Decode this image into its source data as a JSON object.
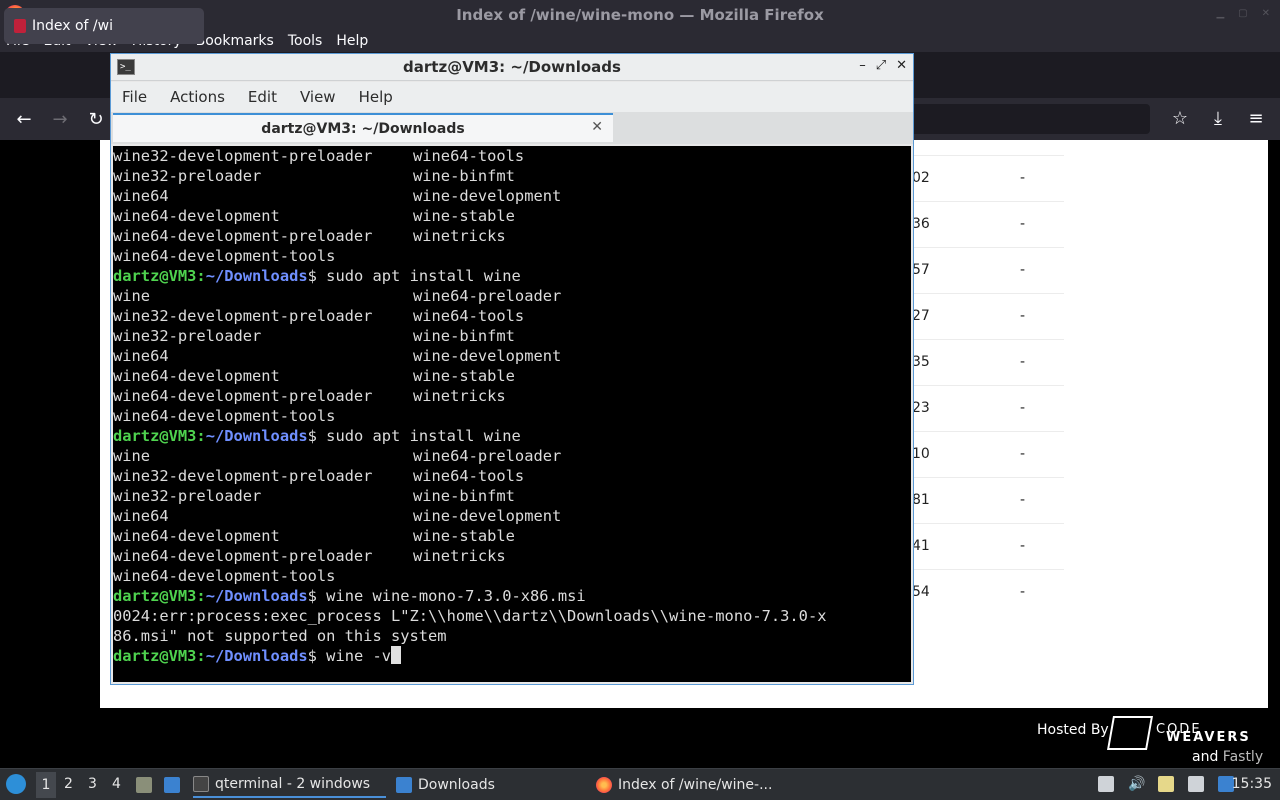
{
  "firefox": {
    "window_title": "Index of /wine/wine-mono — Mozilla Firefox",
    "menu": [
      "File",
      "Edit",
      "View",
      "History",
      "Bookmarks",
      "Tools",
      "Help"
    ],
    "tab_title": "Index of /wine/wine-mono",
    "tab_title_visible": "Index of /wi"
  },
  "page": {
    "rows": [
      {
        "size": "02",
        "mod": "-"
      },
      {
        "size": "36",
        "mod": "-"
      },
      {
        "size": "57",
        "mod": "-"
      },
      {
        "size": "27",
        "mod": "-"
      },
      {
        "size": "35",
        "mod": "-"
      },
      {
        "size": "23",
        "mod": "-"
      },
      {
        "size": "10",
        "mod": "-"
      },
      {
        "size": "81",
        "mod": "-"
      },
      {
        "size": "41",
        "mod": "-"
      },
      {
        "size": "54",
        "mod": "-"
      }
    ],
    "hosted_by": "Hosted By",
    "codeweavers_top": "CODE",
    "codeweavers_bottom": "WEAVERS",
    "and": "and",
    "fastly": "Fastly"
  },
  "terminal": {
    "window_title": "dartz@VM3: ~/Downloads",
    "menu": [
      "File",
      "Actions",
      "Edit",
      "View",
      "Help"
    ],
    "tab_title": "dartz@VM3: ~/Downloads",
    "prompt_user": "dartz@VM3",
    "prompt_path": "~/Downloads",
    "lines": [
      {
        "t": "cols",
        "a": "wine32-development-preloader",
        "b": "wine64-tools"
      },
      {
        "t": "cols",
        "a": "wine32-preloader",
        "b": "wine-binfmt"
      },
      {
        "t": "cols",
        "a": "wine64",
        "b": "wine-development"
      },
      {
        "t": "cols",
        "a": "wine64-development",
        "b": "wine-stable"
      },
      {
        "t": "cols",
        "a": "wine64-development-preloader",
        "b": "winetricks"
      },
      {
        "t": "text",
        "a": "wine64-development-tools"
      },
      {
        "t": "prompt",
        "cmd": "sudo apt install wine"
      },
      {
        "t": "cols",
        "a": "wine",
        "b": "wine64-preloader"
      },
      {
        "t": "cols",
        "a": "wine32-development-preloader",
        "b": "wine64-tools"
      },
      {
        "t": "cols",
        "a": "wine32-preloader",
        "b": "wine-binfmt"
      },
      {
        "t": "cols",
        "a": "wine64",
        "b": "wine-development"
      },
      {
        "t": "cols",
        "a": "wine64-development",
        "b": "wine-stable"
      },
      {
        "t": "cols",
        "a": "wine64-development-preloader",
        "b": "winetricks"
      },
      {
        "t": "text",
        "a": "wine64-development-tools"
      },
      {
        "t": "prompt",
        "cmd": "sudo apt install wine"
      },
      {
        "t": "cols",
        "a": "wine",
        "b": "wine64-preloader"
      },
      {
        "t": "cols",
        "a": "wine32-development-preloader",
        "b": "wine64-tools"
      },
      {
        "t": "cols",
        "a": "wine32-preloader",
        "b": "wine-binfmt"
      },
      {
        "t": "cols",
        "a": "wine64",
        "b": "wine-development"
      },
      {
        "t": "cols",
        "a": "wine64-development",
        "b": "wine-stable"
      },
      {
        "t": "cols",
        "a": "wine64-development-preloader",
        "b": "winetricks"
      },
      {
        "t": "text",
        "a": "wine64-development-tools"
      },
      {
        "t": "prompt",
        "cmd": "wine wine-mono-7.3.0-x86.msi"
      },
      {
        "t": "text",
        "a": "0024:err:process:exec_process L\"Z:\\\\home\\\\dartz\\\\Downloads\\\\wine-mono-7.3.0-x"
      },
      {
        "t": "text",
        "a": "86.msi\" not supported on this system"
      },
      {
        "t": "current",
        "cmd": "wine -v"
      }
    ]
  },
  "taskbar": {
    "workspaces": [
      "1",
      "2",
      "3",
      "4"
    ],
    "tasks": [
      {
        "label": "qterminal - 2 windows",
        "active": true
      },
      {
        "label": "Downloads",
        "active": false
      },
      {
        "label": "Index of /wine/wine-...",
        "active": false
      }
    ],
    "clock": "15:35"
  }
}
